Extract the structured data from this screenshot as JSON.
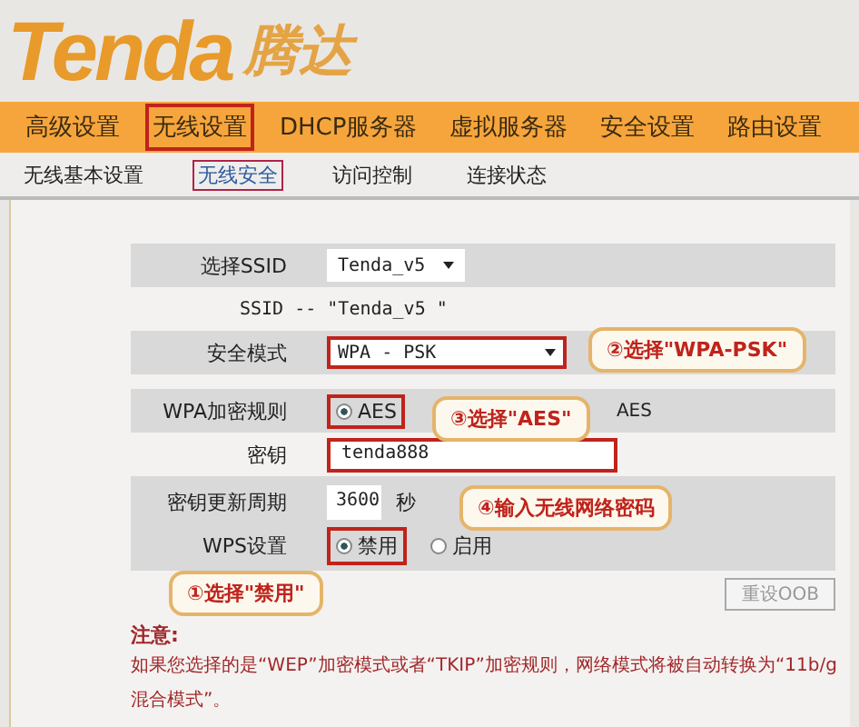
{
  "logo": {
    "latin": "Tenda",
    "chinese": "腾达"
  },
  "nav": [
    {
      "label": "高级设置",
      "selected": false
    },
    {
      "label": "无线设置",
      "selected": true
    },
    {
      "label": "DHCP服务器",
      "selected": false
    },
    {
      "label": "虚拟服务器",
      "selected": false
    },
    {
      "label": "安全设置",
      "selected": false
    },
    {
      "label": "路由设置",
      "selected": false
    }
  ],
  "subnav": [
    {
      "label": "无线基本设置",
      "selected": false
    },
    {
      "label": "无线安全",
      "selected": true
    },
    {
      "label": "访问控制",
      "selected": false
    },
    {
      "label": "连接状态",
      "selected": false
    }
  ],
  "form": {
    "ssid_label": "选择SSID",
    "ssid_value": "Tenda_v5",
    "ssid_caption": "SSID -- \"Tenda_v5 \"",
    "mode_label": "安全模式",
    "mode_value": "WPA - PSK",
    "mode_highlighted": true,
    "rule_label": "WPA加密规则",
    "rule_options": [
      {
        "label": "AES",
        "selected": true,
        "highlighted": true
      }
    ],
    "rule_other_text": "AES",
    "key_label": "密钥",
    "key_value": "tenda888",
    "key_highlighted": true,
    "period_label": "密钥更新周期",
    "period_value": "3600",
    "period_unit": "秒",
    "wps_label": "WPS设置",
    "wps_options": [
      {
        "label": "禁用",
        "selected": true,
        "highlighted": true
      },
      {
        "label": "启用",
        "selected": false,
        "highlighted": false
      }
    ],
    "reset_button": "重设OOB"
  },
  "note": {
    "title": "注意:",
    "text": "如果您选择的是“WEP”加密模式或者“TKIP”加密规则，网络模式将被自动转换为“11b/g混合模式”。"
  },
  "callouts": [
    {
      "text": "②选择\"WPA-PSK\""
    },
    {
      "text": "③选择\"AES\""
    },
    {
      "text": "④输入无线网络密码"
    },
    {
      "text": "①选择\"禁用\""
    }
  ]
}
